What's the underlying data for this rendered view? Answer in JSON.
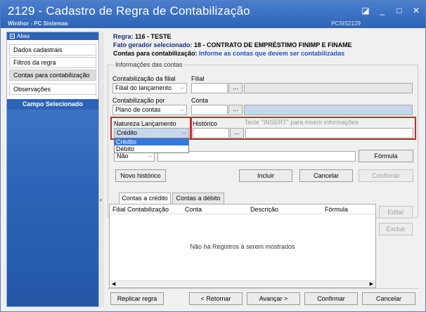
{
  "window": {
    "title": "2129 - Cadastro de Regra de Contabilização",
    "subtitle": "Winthor - PC Sistemas",
    "code": "PCSIS2129",
    "controls": [
      "◪",
      "_",
      "□",
      "✕"
    ]
  },
  "sidebar": {
    "header": "Abas",
    "items": [
      {
        "label": "Dados cadastrais"
      },
      {
        "label": "Filtros da regra"
      },
      {
        "label": "Contas para contabilização"
      },
      {
        "label": "Observações"
      }
    ],
    "selected_field_header": "Campo Selecionado"
  },
  "info": {
    "regra_label": "Regra:",
    "regra_value": "116 - TESTE",
    "fato_label": "Fato gerador selecionado:",
    "fato_value": "18 - CONTRATO DE EMPRÉSTIMO FINIMP E FINAME",
    "contas_label": "Contas para contabilização:",
    "contas_value": "Informe as contas que devem ser contabilizadas"
  },
  "group": {
    "title": "Informações das contas",
    "contab_filial_label": "Contabilização da filial",
    "contab_filial_value": "Filial do lançamento",
    "filial_label": "Filial",
    "filial_btn": "...",
    "contab_por_label": "Contabilização por",
    "contab_por_value": "Plano de contas",
    "conta_label": "Conta",
    "conta_btn": "...",
    "natureza_label": "Natureza Lançamento",
    "natureza_value": "Crédito",
    "natureza_options": [
      "Crédito",
      "Débito"
    ],
    "historico_label": "Histórico",
    "historico_hint": "Tecle  \"INSERT\" para inserir informações",
    "historico_btn": "...",
    "nao_value": "Não",
    "formula_btn": "Fórmula",
    "novo_historico_btn": "Novo histórico",
    "incluir_btn": "Incluir",
    "cancelar_btn": "Cancelar",
    "confirmar_btn": "Confirmar"
  },
  "tabs": [
    {
      "label": "Contas a crédito"
    },
    {
      "label": "Contas a débito"
    }
  ],
  "grid": {
    "columns": [
      "Filial Contabilização",
      "Conta",
      "Descrição",
      "Fórmula"
    ],
    "empty_message": "Não há Registros à serem mostrados",
    "editar_btn": "Editar",
    "excluir_btn": "Excluir"
  },
  "footer": {
    "replicar_btn": "Replicar regra",
    "retornar_btn": "< Retornar",
    "avancar_btn": "Avançar >",
    "confirmar_btn": "Confirmar",
    "cancelar_btn": "Cancelar"
  },
  "colors": {
    "title_bar": "#2d63b6",
    "highlight_border": "#e0202a",
    "navy_label": "#1a2f7a",
    "blue_label": "#2050c0"
  }
}
